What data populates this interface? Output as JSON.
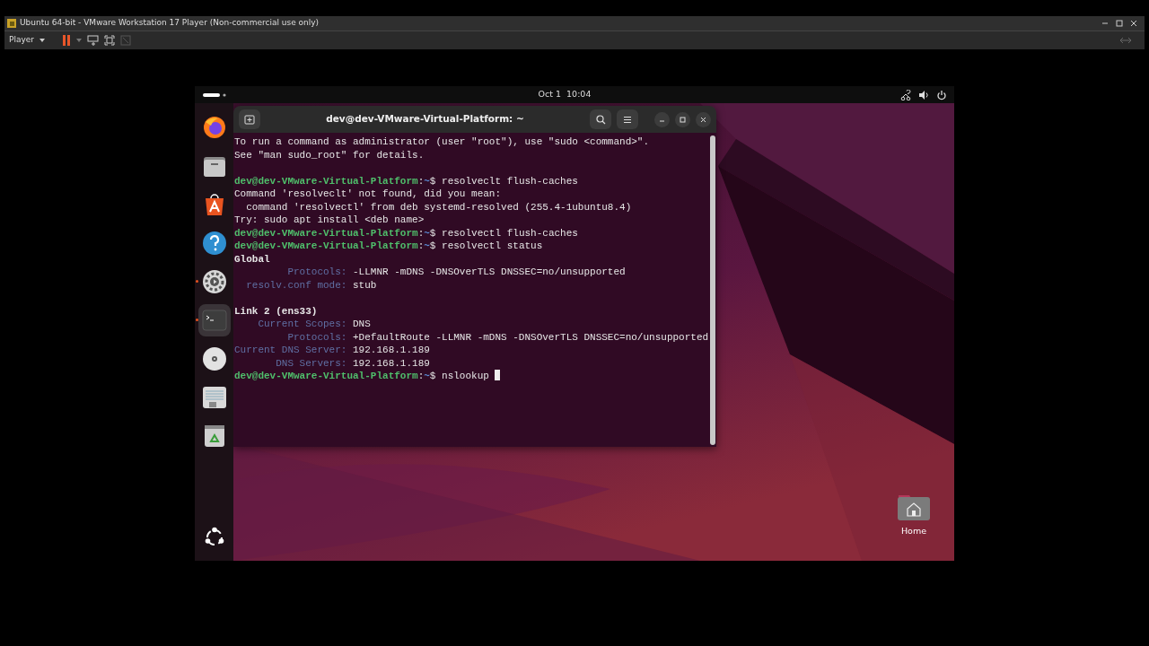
{
  "vmware": {
    "title": "Ubuntu 64-bit - VMware Workstation 17 Player (Non-commercial use only)",
    "menu": "Player"
  },
  "topbar": {
    "clock": "Oct 1  10:04"
  },
  "dock": [
    {
      "kind": "browser",
      "selected": false,
      "running": false
    },
    {
      "kind": "files",
      "selected": false,
      "running": false
    },
    {
      "kind": "store",
      "selected": false,
      "running": false
    },
    {
      "kind": "help",
      "selected": false,
      "running": false
    },
    {
      "kind": "settings",
      "selected": false,
      "running": true
    },
    {
      "kind": "terminal",
      "selected": true,
      "running": true
    },
    {
      "kind": "disc",
      "selected": false,
      "running": false
    },
    {
      "kind": "document",
      "selected": false,
      "running": false
    },
    {
      "kind": "trash",
      "selected": false,
      "running": false
    },
    {
      "kind": "apps",
      "selected": false,
      "running": false
    }
  ],
  "terminal": {
    "title": "dev@dev-VMware-Virtual-Platform: ~",
    "lines": [
      {
        "kind": "output",
        "text": "To run a command as administrator (user \"root\"), use \"sudo <command>\"."
      },
      {
        "kind": "output",
        "text": "See \"man sudo_root\" for details."
      },
      {
        "kind": "blank"
      },
      {
        "kind": "prompt",
        "user": "dev@dev-VMware-Virtual-Platform",
        "sep": ":",
        "path": "~",
        "sigil": "$",
        "command": "resolveclt flush-caches"
      },
      {
        "kind": "output",
        "text": "Command 'resolveclt' not found, did you mean:"
      },
      {
        "kind": "output",
        "text": "  command 'resolvectl' from deb systemd-resolved (255.4-1ubuntu8.4)"
      },
      {
        "kind": "output",
        "text": "Try: sudo apt install <deb name>"
      },
      {
        "kind": "prompt",
        "user": "dev@dev-VMware-Virtual-Platform",
        "sep": ":",
        "path": "~",
        "sigil": "$",
        "command": "resolvectl flush-caches"
      },
      {
        "kind": "prompt",
        "user": "dev@dev-VMware-Virtual-Platform",
        "sep": ":",
        "path": "~",
        "sigil": "$",
        "command": "resolvectl status"
      },
      {
        "kind": "heading",
        "text": "Global"
      },
      {
        "kind": "field",
        "key": "Protocols:",
        "value": "-LLMNR -mDNS -DNSOverTLS DNSSEC=no/unsupported"
      },
      {
        "kind": "field",
        "key": "resolv.conf mode:",
        "value": "stub"
      },
      {
        "kind": "blank"
      },
      {
        "kind": "heading",
        "text": "Link 2 (ens33)"
      },
      {
        "kind": "field",
        "key": "Current Scopes:",
        "value": "DNS"
      },
      {
        "kind": "field",
        "key": "Protocols:",
        "value": "+DefaultRoute -LLMNR -mDNS -DNSOverTLS DNSSEC=no/unsupported"
      },
      {
        "kind": "field",
        "key": "Current DNS Server:",
        "value": "192.168.1.189"
      },
      {
        "kind": "field",
        "key": "DNS Servers:",
        "value": "192.168.1.189"
      },
      {
        "kind": "prompt",
        "user": "dev@dev-VMware-Virtual-Platform",
        "sep": ":",
        "path": "~",
        "sigil": "$",
        "command": "nslookup",
        "cursor": true
      }
    ]
  },
  "desktop_icons": [
    {
      "label": "Home"
    }
  ]
}
